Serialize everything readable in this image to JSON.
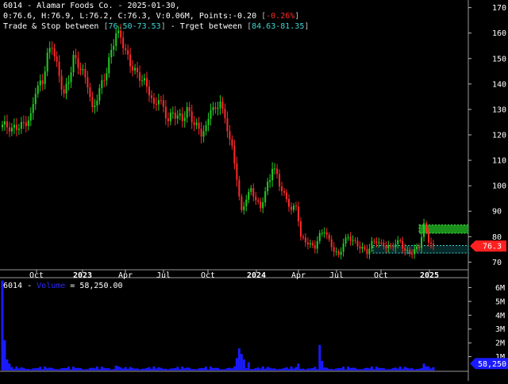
{
  "header": {
    "line1": {
      "prefix": "6014 - Alamar Foods Co. - 2025-01-30,",
      "ohlc": "0:76.6, H:76.9, L:76.2, C:76.3, V:0.06M, Points:-0.20 ",
      "change": "-0.26%"
    },
    "line2": {
      "label1": "Trade & Stop between ",
      "range1": "76.50-73.53",
      "label2": " - Trget between ",
      "range2": "84.63-81.35"
    }
  },
  "volume_header": {
    "ticker": "6014 - ",
    "label": "Volume",
    "value": " = 58,250.00"
  },
  "colors": {
    "background": "#000000",
    "up_candle": "#22cc22",
    "down_candle": "#ff2a2a",
    "volume": "#1a1aff",
    "target_zone": "#1a8f1a",
    "stop_zone": "#3fd4d4",
    "last_price_tag": "#ff2020",
    "volume_tag": "#1a1aff"
  },
  "chart_data": [
    {
      "type": "candlestick",
      "ticker": "6014",
      "name": "Alamar Foods Co.",
      "x_ticks": [
        "Oct",
        "2023",
        "Apr",
        "Jul",
        "Oct",
        "2024",
        "Apr",
        "Jul",
        "Oct",
        "2025"
      ],
      "y_ticks": [
        70,
        80,
        90,
        100,
        110,
        120,
        130,
        140,
        150,
        160,
        170
      ],
      "ylim": [
        67,
        173
      ],
      "last_close": 76.3,
      "last_price_label": "76.3",
      "close_path": [
        [
          0,
          124
        ],
        [
          4,
          121
        ],
        [
          8,
          124
        ],
        [
          12,
          128
        ],
        [
          14,
          138
        ],
        [
          17,
          140
        ],
        [
          19,
          150
        ],
        [
          21,
          155
        ],
        [
          24,
          144
        ],
        [
          26,
          137
        ],
        [
          28,
          142
        ],
        [
          30,
          150
        ],
        [
          33,
          145
        ],
        [
          36,
          140
        ],
        [
          38,
          130
        ],
        [
          40,
          136
        ],
        [
          42,
          141
        ],
        [
          44,
          145
        ],
        [
          46,
          152
        ],
        [
          48,
          159
        ],
        [
          50,
          158
        ],
        [
          52,
          153
        ],
        [
          54,
          149
        ],
        [
          56,
          146
        ],
        [
          58,
          143
        ],
        [
          60,
          140
        ],
        [
          62,
          136
        ],
        [
          64,
          130
        ],
        [
          66,
          135
        ],
        [
          68,
          131
        ],
        [
          70,
          127
        ],
        [
          72,
          129
        ],
        [
          74,
          127
        ],
        [
          76,
          125
        ],
        [
          78,
          129
        ],
        [
          80,
          126
        ],
        [
          82,
          124
        ],
        [
          84,
          122
        ],
        [
          86,
          123
        ],
        [
          88,
          131
        ],
        [
          90,
          128
        ],
        [
          92,
          133
        ],
        [
          93,
          128
        ],
        [
          95,
          123
        ],
        [
          97,
          115
        ],
        [
          99,
          105
        ],
        [
          100,
          96
        ],
        [
          101,
          90
        ],
        [
          103,
          95
        ],
        [
          105,
          98
        ],
        [
          107,
          94
        ],
        [
          109,
          91
        ],
        [
          111,
          98
        ],
        [
          113,
          104
        ],
        [
          114,
          109
        ],
        [
          116,
          104
        ],
        [
          118,
          98
        ],
        [
          120,
          94
        ],
        [
          122,
          90
        ],
        [
          124,
          92
        ],
        [
          125,
          87
        ],
        [
          126,
          80
        ],
        [
          128,
          79
        ],
        [
          130,
          77
        ],
        [
          132,
          76
        ],
        [
          134,
          80
        ],
        [
          136,
          82
        ],
        [
          138,
          78
        ],
        [
          140,
          75
        ],
        [
          142,
          73
        ],
        [
          144,
          78
        ],
        [
          146,
          80
        ],
        [
          148,
          78
        ],
        [
          150,
          76
        ],
        [
          152,
          75
        ],
        [
          154,
          74
        ],
        [
          156,
          78
        ],
        [
          158,
          79
        ],
        [
          160,
          77
        ],
        [
          162,
          76
        ],
        [
          164,
          75
        ],
        [
          166,
          77
        ],
        [
          168,
          78
        ],
        [
          170,
          75
        ],
        [
          172,
          74
        ],
        [
          174,
          75
        ],
        [
          176,
          76
        ],
        [
          177,
          80
        ],
        [
          178,
          84
        ],
        [
          179,
          81
        ],
        [
          180,
          78
        ],
        [
          181,
          77
        ],
        [
          182,
          76.3
        ]
      ],
      "target_zone": [
        84.63,
        81.35
      ],
      "stop_zone": [
        76.5,
        73.53
      ]
    },
    {
      "type": "bar",
      "series": [
        {
          "name": "Volume"
        }
      ],
      "y_ticks": [
        "1M",
        "2M",
        "3M",
        "4M",
        "5M",
        "6M"
      ],
      "ylim": [
        0,
        6.6
      ],
      "last_value_label": "58,250",
      "spikes": [
        [
          0,
          6.5
        ],
        [
          1,
          2.2
        ],
        [
          2,
          0.8
        ],
        [
          3,
          0.5
        ],
        [
          48,
          0.35
        ],
        [
          49,
          0.3
        ],
        [
          52,
          0.25
        ],
        [
          99,
          0.9
        ],
        [
          100,
          1.6
        ],
        [
          101,
          1.2
        ],
        [
          102,
          0.8
        ],
        [
          104,
          0.6
        ],
        [
          125,
          0.5
        ],
        [
          134,
          1.85
        ],
        [
          135,
          0.7
        ],
        [
          178,
          0.5
        ],
        [
          179,
          0.3
        ]
      ]
    }
  ]
}
